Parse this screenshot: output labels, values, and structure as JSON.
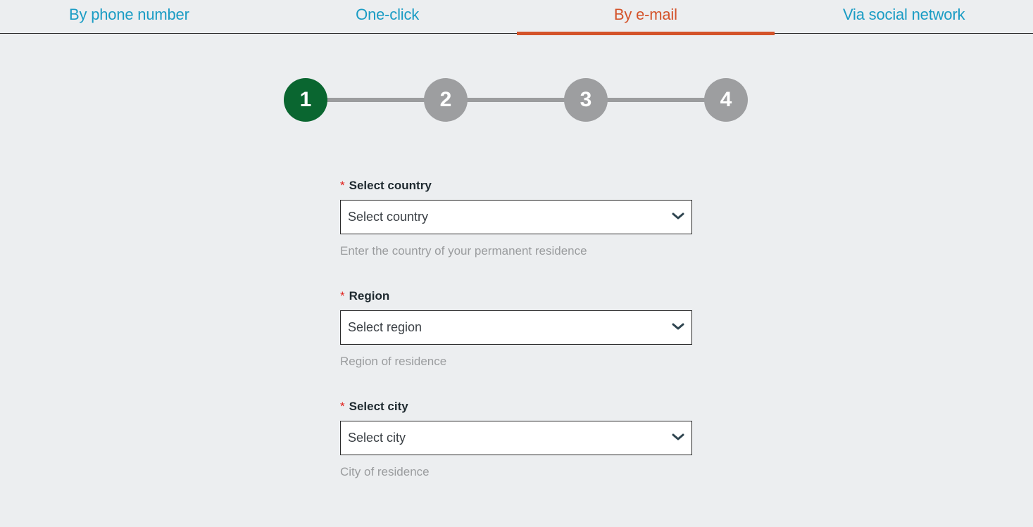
{
  "tabs": [
    {
      "label": "By phone number",
      "active": false
    },
    {
      "label": "One-click",
      "active": false
    },
    {
      "label": "By e-mail",
      "active": true
    },
    {
      "label": "Via social network",
      "active": false
    }
  ],
  "stepper": {
    "current_step": 1,
    "steps": [
      "1",
      "2",
      "3",
      "4"
    ]
  },
  "form": {
    "fields": [
      {
        "required_marker": "*",
        "label": "Select country",
        "value": "Select country",
        "hint": "Enter the country of your permanent residence",
        "icon": "chevron-down-icon"
      },
      {
        "required_marker": "*",
        "label": "Region",
        "value": "Select region",
        "hint": "Region of residence",
        "icon": "chevron-down-icon"
      },
      {
        "required_marker": "*",
        "label": "Select city",
        "value": "Select city",
        "hint": "City of residence",
        "icon": "chevron-down-icon"
      }
    ]
  },
  "colors": {
    "background": "#eceef0",
    "tab_inactive": "#1a9cc4",
    "tab_active": "#d4532a",
    "step_active": "#0a6630",
    "step_inactive": "#9d9ea0",
    "required": "#e0201b",
    "hint": "#9a9c9e"
  }
}
